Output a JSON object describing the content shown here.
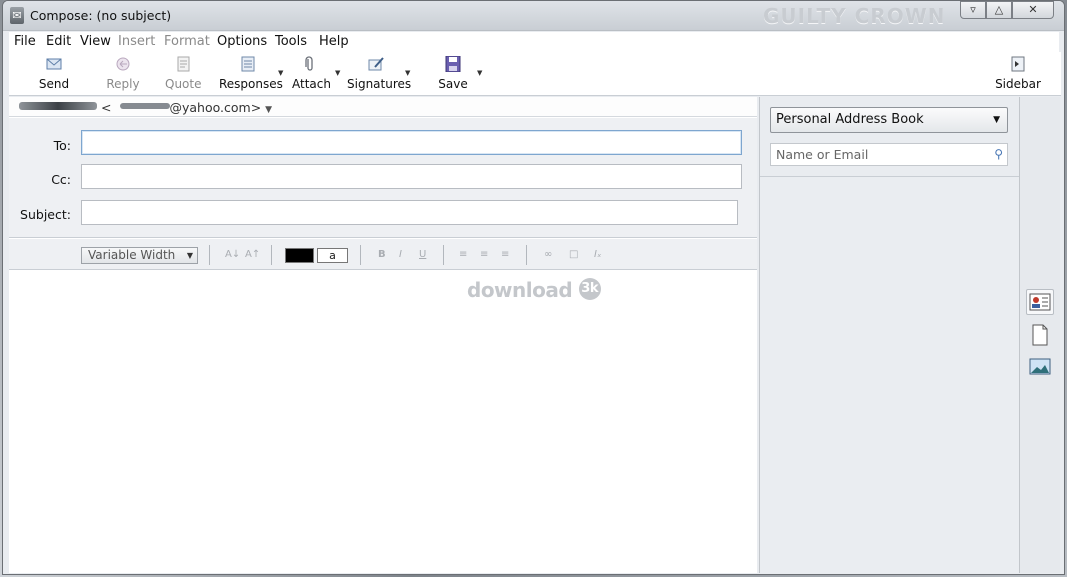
{
  "window": {
    "title": "Compose: (no subject)",
    "brand": "GUILTY CROWN"
  },
  "menu": [
    "File",
    "Edit",
    "View",
    "Insert",
    "Format",
    "Options",
    "Tools",
    "Help"
  ],
  "toolbar": {
    "send": "Send",
    "reply": "Reply",
    "quote": "Quote",
    "responses": "Responses",
    "attach": "Attach",
    "signatures": "Signatures",
    "save": "Save",
    "sidebar": "Sidebar"
  },
  "from": {
    "address_tail": "@yahoo.com>",
    "address_head": "<"
  },
  "fields": {
    "to_label": "To:",
    "cc_label": "Cc:",
    "subject_label": "Subject:",
    "to_value": "",
    "cc_value": "",
    "subject_value": ""
  },
  "format": {
    "font": "Variable Width",
    "bg_sample": "a"
  },
  "watermark": {
    "text": "download",
    "badge": "3k"
  },
  "sidebar": {
    "address_book": "Personal Address Book",
    "search_placeholder": "Name or Email"
  },
  "colors": {
    "text_color": "#000000",
    "focus_border": "#7ea6cf"
  }
}
